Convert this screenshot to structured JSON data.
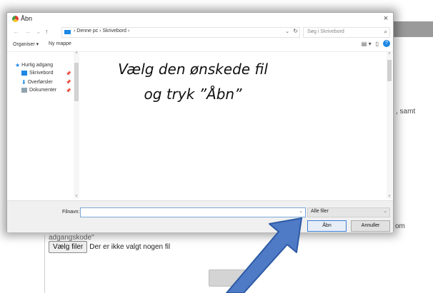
{
  "dialog": {
    "title": "Åbn",
    "close": "×",
    "nav": {
      "back": "←",
      "forward": "→",
      "recent": "⌄",
      "up": "↑",
      "breadcrumb": "›  Denne pc  ›  Skrivebord  ›",
      "dropdown": "⌄",
      "refresh": "↻"
    },
    "search_placeholder": "Søg i Skrivebord",
    "toolbar": {
      "organize": "Organiser ▾",
      "new_folder": "Ny mappe"
    },
    "sidebar": {
      "items": [
        {
          "label": "Hurtig adgang"
        },
        {
          "label": "Skrivebord"
        },
        {
          "label": "Overførsler"
        },
        {
          "label": "Dokumenter"
        }
      ]
    },
    "instruction_line1": "Vælg den ønskede fil",
    "instruction_line2": "og tryk ”Åbn”",
    "filename_label": "Filnavn:",
    "filename_value": "",
    "file_type": "Alle filer",
    "open_button": "Åbn",
    "cancel_button": "Annuller"
  },
  "background_page": {
    "text_right_1": ", samt",
    "text_right_2": "om",
    "text_cut": "adgangskode\"",
    "choose_button": "Vælg filer",
    "no_file_text": "Der er ikke valgt nogen fil"
  },
  "colors": {
    "accent": "#1e88e5",
    "arrow_fill": "#4f7bc6",
    "arrow_stroke": "#2d5aa5",
    "dialog_border": "#a8a8a8",
    "open_button_border": "#3c7fd6"
  }
}
